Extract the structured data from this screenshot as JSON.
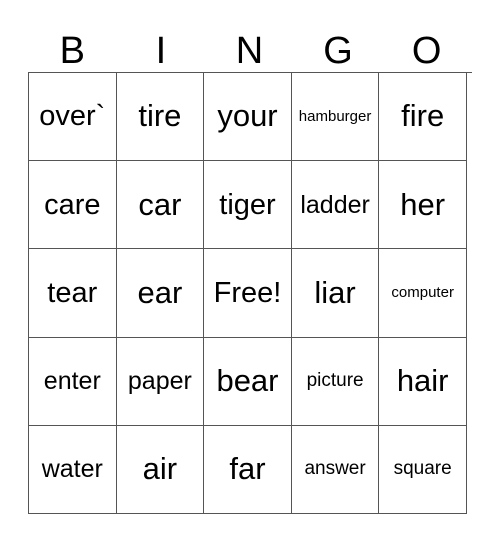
{
  "card": {
    "header_letters": [
      "B",
      "I",
      "N",
      "G",
      "O"
    ],
    "free_space_label": "Free!",
    "border_color": "#555555",
    "background_color": "#ffffff",
    "text_color": "#000000",
    "columns": 5,
    "rows": 5,
    "cells": [
      [
        {
          "text": "over`",
          "size": "lg"
        },
        {
          "text": "tire",
          "size": "xl"
        },
        {
          "text": "your",
          "size": "xl"
        },
        {
          "text": "hamburger",
          "size": "xs"
        },
        {
          "text": "fire",
          "size": "xl"
        }
      ],
      [
        {
          "text": "care",
          "size": "lg"
        },
        {
          "text": "car",
          "size": "xl"
        },
        {
          "text": "tiger",
          "size": "lg"
        },
        {
          "text": "ladder",
          "size": "md"
        },
        {
          "text": "her",
          "size": "xl"
        }
      ],
      [
        {
          "text": "tear",
          "size": "lg"
        },
        {
          "text": "ear",
          "size": "xl"
        },
        {
          "text": "Free!",
          "size": "lg"
        },
        {
          "text": "liar",
          "size": "xl"
        },
        {
          "text": "computer",
          "size": "xs"
        }
      ],
      [
        {
          "text": "enter",
          "size": "md"
        },
        {
          "text": "paper",
          "size": "md"
        },
        {
          "text": "bear",
          "size": "xl"
        },
        {
          "text": "picture",
          "size": "sm"
        },
        {
          "text": "hair",
          "size": "xl"
        }
      ],
      [
        {
          "text": "water",
          "size": "md"
        },
        {
          "text": "air",
          "size": "xl"
        },
        {
          "text": "far",
          "size": "xl"
        },
        {
          "text": "answer",
          "size": "sm"
        },
        {
          "text": "square",
          "size": "sm"
        }
      ]
    ]
  }
}
